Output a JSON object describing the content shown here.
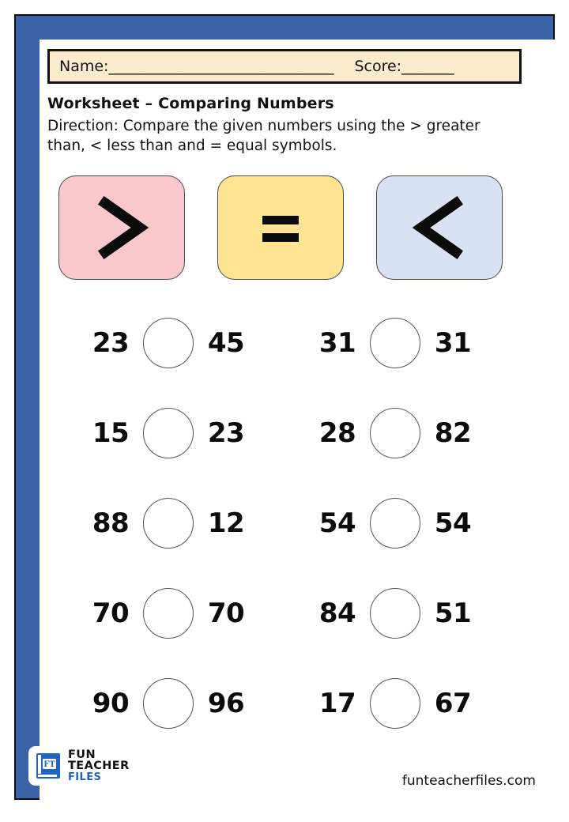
{
  "page": {
    "frame_color": "#3a63a8",
    "frame_outline_color": "#0d0d0d",
    "background": "#ffffff"
  },
  "header": {
    "name_label": "Name:______________________________",
    "score_label": "Score:_______",
    "bar_fill": "#fbeccd",
    "bar_border": "#111111"
  },
  "title": "Worksheet – Comparing Numbers",
  "direction": "Direction: Compare the given numbers using the > greater than, < less than and = equal symbols.",
  "symbol_cards": [
    {
      "symbol": ">",
      "name": "greater-than",
      "fill": "#f9c8cc"
    },
    {
      "symbol": "=",
      "name": "equal-to",
      "fill": "#ffe493"
    },
    {
      "symbol": "<",
      "name": "less-than",
      "fill": "#d9e2f3"
    }
  ],
  "problems": {
    "circle_value": "",
    "rows": [
      {
        "left": {
          "a": "23",
          "b": "45"
        },
        "right": {
          "a": "31",
          "b": "31"
        }
      },
      {
        "left": {
          "a": "15",
          "b": "23"
        },
        "right": {
          "a": "28",
          "b": "82"
        }
      },
      {
        "left": {
          "a": "88",
          "b": "12"
        },
        "right": {
          "a": "54",
          "b": "54"
        }
      },
      {
        "left": {
          "a": "70",
          "b": "70"
        },
        "right": {
          "a": "84",
          "b": "51"
        }
      },
      {
        "left": {
          "a": "90",
          "b": "96"
        },
        "right": {
          "a": "17",
          "b": "67"
        }
      }
    ]
  },
  "footer": {
    "logo_mark_text": "FT",
    "logo_line1": "FUN TEACHER",
    "logo_line2": "FILES",
    "logo_blue": "#1f63c4",
    "website": "funteacherfiles.com"
  }
}
